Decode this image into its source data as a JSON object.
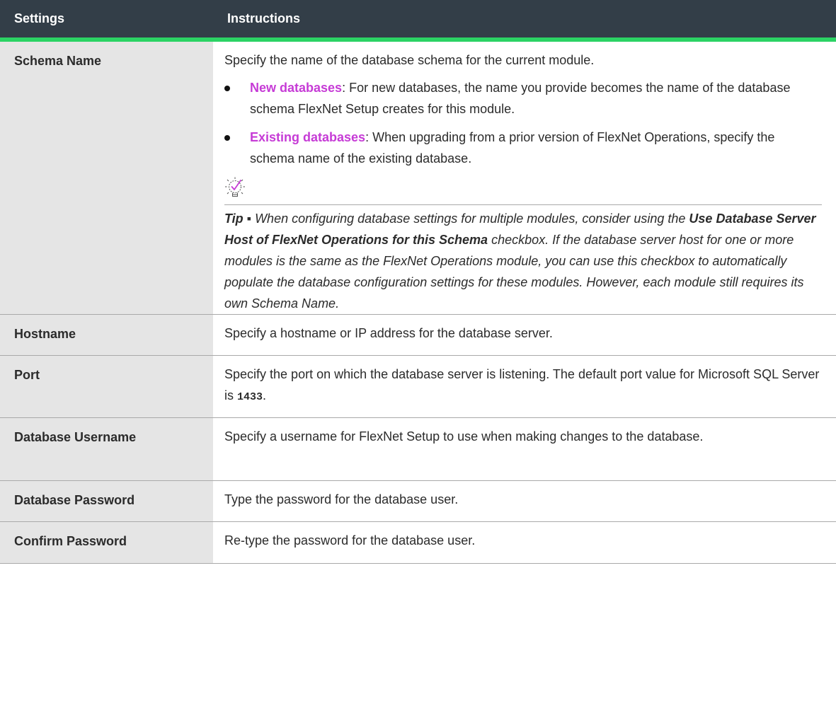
{
  "header": {
    "col1": "Settings",
    "col2": "Instructions"
  },
  "rows": {
    "schema": {
      "label": "Schema Name",
      "intro": "Specify the name of the database schema for the current module.",
      "bullets": [
        {
          "term": "New databases",
          "sep": ": ",
          "text": "For new databases, the name you provide becomes the name of the database schema FlexNet Setup creates for this module."
        },
        {
          "term": "Existing databases",
          "sep": ": ",
          "text": "When upgrading from a prior version of FlexNet Operations, specify the schema name of the existing database."
        }
      ],
      "tip": {
        "lead": "Tip ▪",
        "part1": " When configuring database settings for multiple modules, consider using the ",
        "bold": "Use Database Server Host of FlexNet Operations for this Schema",
        "part2": " checkbox. If the database server host for one or more modules is the same as the FlexNet Operations module, you can use this checkbox to automatically populate the database configuration settings for these modules. However, each module still requires its own Schema Name."
      }
    },
    "hostname": {
      "label": "Hostname",
      "text": "Specify a hostname or IP address for the database server."
    },
    "port": {
      "label": "Port",
      "text": "Specify the port on which the database server is listening. The default port value for Microsoft SQL Server is ",
      "value": "1433",
      "end": "."
    },
    "username": {
      "label": "Database Username",
      "text": "Specify a username for FlexNet Setup to use when making changes to the database."
    },
    "password": {
      "label": "Database Password",
      "text": "Type the password for the database user."
    },
    "confirm": {
      "label": "Confirm Password",
      "text": "Re-type the password for the database user."
    }
  },
  "icons": {
    "tip": "lightbulb-check-icon"
  },
  "colors": {
    "header_bg": "#333e48",
    "header_rule": "#2bd364",
    "label_bg": "#e5e5e5",
    "term": "#c63bd6"
  }
}
